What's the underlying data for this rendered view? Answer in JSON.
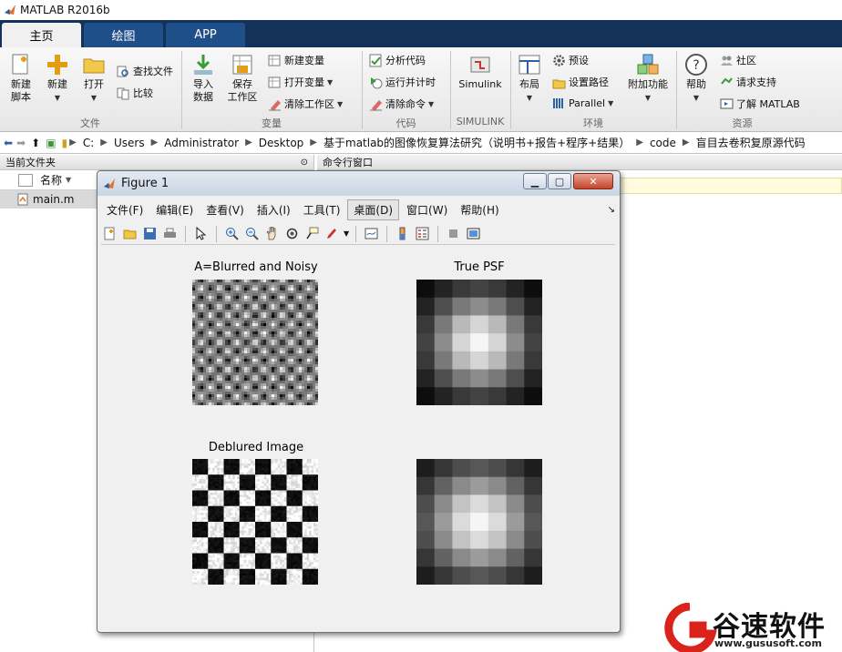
{
  "app": {
    "title": "MATLAB R2016b"
  },
  "tabs": [
    {
      "label": "主页"
    },
    {
      "label": "绘图"
    },
    {
      "label": "APP"
    }
  ],
  "ribbon": {
    "new_script": "新建\n脚本",
    "new": "新建",
    "open": "打开",
    "find_files": "查找文件",
    "compare": "比较",
    "import_data": "导入\n数据",
    "save_workspace": "保存\n工作区",
    "new_variable": "新建变量",
    "open_variable": "打开变量",
    "clear_workspace": "清除工作区",
    "analyze_code": "分析代码",
    "run_and_time": "运行并计时",
    "clear_commands": "清除命令",
    "simulink": "Simulink",
    "layout": "布局",
    "preferences": "预设",
    "set_path": "设置路径",
    "parallel": "Parallel",
    "addons": "附加功能",
    "help": "帮助",
    "community": "社区",
    "request_support": "请求支持",
    "learn_matlab": "了解 MATLAB",
    "groups": {
      "file": "文件",
      "variable": "变量",
      "code": "代码",
      "simulink": "SIMULINK",
      "environment": "环境",
      "resources": "资源"
    }
  },
  "address": {
    "segments": [
      "C:",
      "Users",
      "Administrator",
      "Desktop",
      "基于matlab的图像恢复算法研究（说明书+报告+程序+结果）",
      "code",
      "盲目去卷积复原源代码"
    ]
  },
  "left_panel": {
    "title": "当前文件夹",
    "col_name": "名称",
    "files": [
      {
        "name": "main.m"
      }
    ]
  },
  "right_panel": {
    "title": "命令行窗口"
  },
  "figure": {
    "title": "Figure 1",
    "menu": [
      "文件(F)",
      "编辑(E)",
      "查看(V)",
      "插入(I)",
      "工具(T)",
      "桌面(D)",
      "窗口(W)",
      "帮助(H)"
    ],
    "selected_menu": "桌面(D)",
    "plots": [
      {
        "title": "A=Blurred and Noisy"
      },
      {
        "title": "True PSF"
      },
      {
        "title": "Deblured Image"
      },
      {
        "title": ""
      }
    ]
  },
  "watermark": {
    "brand": "谷速软件",
    "url": "www.gususoft.com"
  },
  "colors": {
    "tab_bar": "#14315a",
    "tab_inactive": "#1f4f89",
    "brand_red": "#d9231b"
  }
}
